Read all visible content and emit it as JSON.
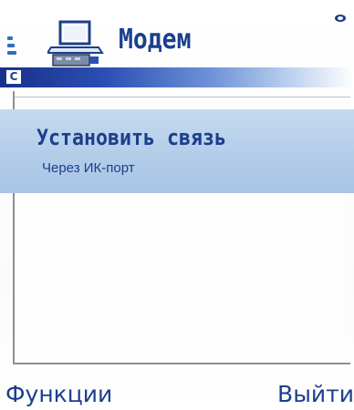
{
  "app": {
    "title": "Модем",
    "icon": "modem-laptop-icon"
  },
  "context_bar": {
    "input_mode_icon": "C",
    "accent_color": "#1b3f8c"
  },
  "list": {
    "items": [
      {
        "title": "Установить связь",
        "subtitle": "Через ИК-порт",
        "selected": true
      }
    ],
    "highlight_color": "#b3cde9"
  },
  "softkeys": {
    "left": "Функции",
    "right": "Выйти"
  },
  "icons": {
    "signal": "signal-strength-icon",
    "battery": "battery-icon",
    "app": "modem-laptop-icon",
    "input_mode": "input-mode-icon"
  }
}
